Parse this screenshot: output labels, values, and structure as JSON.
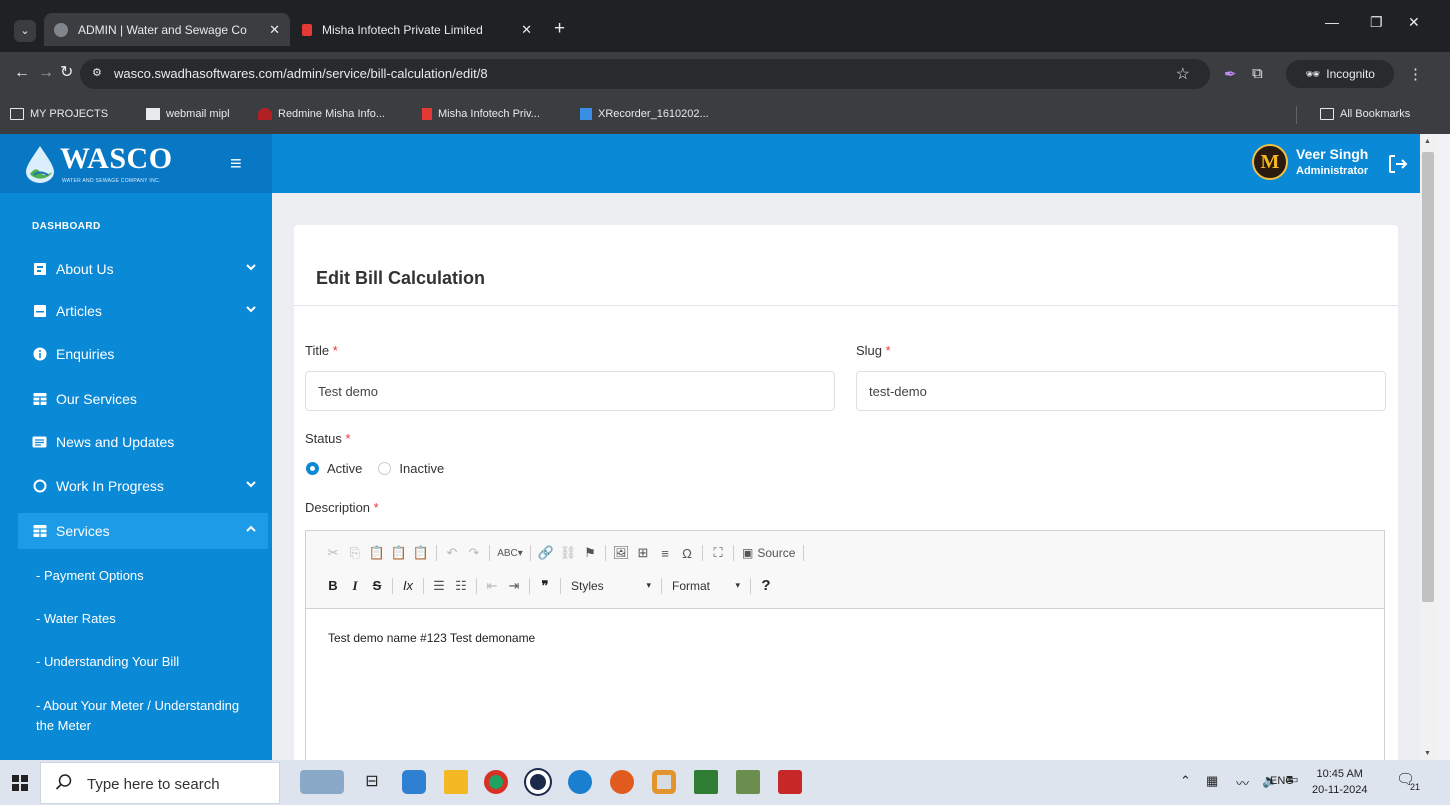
{
  "browser": {
    "tabs": [
      {
        "title": "ADMIN | Water and Sewage Co",
        "active": true
      },
      {
        "title": "Misha Infotech Private Limited",
        "active": false
      }
    ],
    "url": "wasco.swadhasoftwares.com/admin/service/bill-calculation/edit/8",
    "incognito_label": "Incognito",
    "bookmarks": [
      "MY PROJECTS",
      "webmail mipl",
      "Redmine Misha Info...",
      "Misha Infotech Priv...",
      "XRecorder_1610202..."
    ],
    "all_bookmarks": "All Bookmarks"
  },
  "app": {
    "logo_text": "WASCO",
    "logo_tagline": "WATER AND SEWAGE COMPANY INC.",
    "user": {
      "name": "Veer Singh",
      "role": "Administrator",
      "avatar_letter": "M"
    }
  },
  "sidebar": {
    "heading": "DASHBOARD",
    "items": [
      {
        "label": "About Us",
        "icon": "id-card-icon"
      },
      {
        "label": "Articles",
        "icon": "article-icon"
      },
      {
        "label": "Enquiries",
        "icon": "info-icon"
      },
      {
        "label": "Our Services",
        "icon": "grid-icon"
      },
      {
        "label": "News and Updates",
        "icon": "newspaper-icon"
      },
      {
        "label": "Work In Progress",
        "icon": "circle-icon"
      },
      {
        "label": "Services",
        "icon": "grid-icon"
      }
    ],
    "sub_items": [
      "- Payment Options",
      "- Water Rates",
      "- Understanding Your Bill",
      "- About Your Meter / Understanding the Meter"
    ]
  },
  "form": {
    "title": "Edit Bill Calculation",
    "title_label": "Title",
    "title_value": "Test demo",
    "slug_label": "Slug",
    "slug_value": "test-demo",
    "status_label": "Status",
    "status_options": [
      "Active",
      "Inactive"
    ],
    "status_selected": "Active",
    "description_label": "Description",
    "description_value": "Test demo name #123 Test demoname",
    "required_marker": "*"
  },
  "editor_toolbar": {
    "source_label": "Source",
    "styles_label": "Styles",
    "format_label": "Format",
    "help_label": "?"
  },
  "taskbar": {
    "search_placeholder": "Type here to search",
    "language": "ENG",
    "time": "10:45 AM",
    "date": "20-11-2024",
    "notification_count": "21"
  },
  "colors": {
    "primary": "#0a89d6",
    "sidebar_active": "#1d9be6",
    "required": "#e53935"
  }
}
